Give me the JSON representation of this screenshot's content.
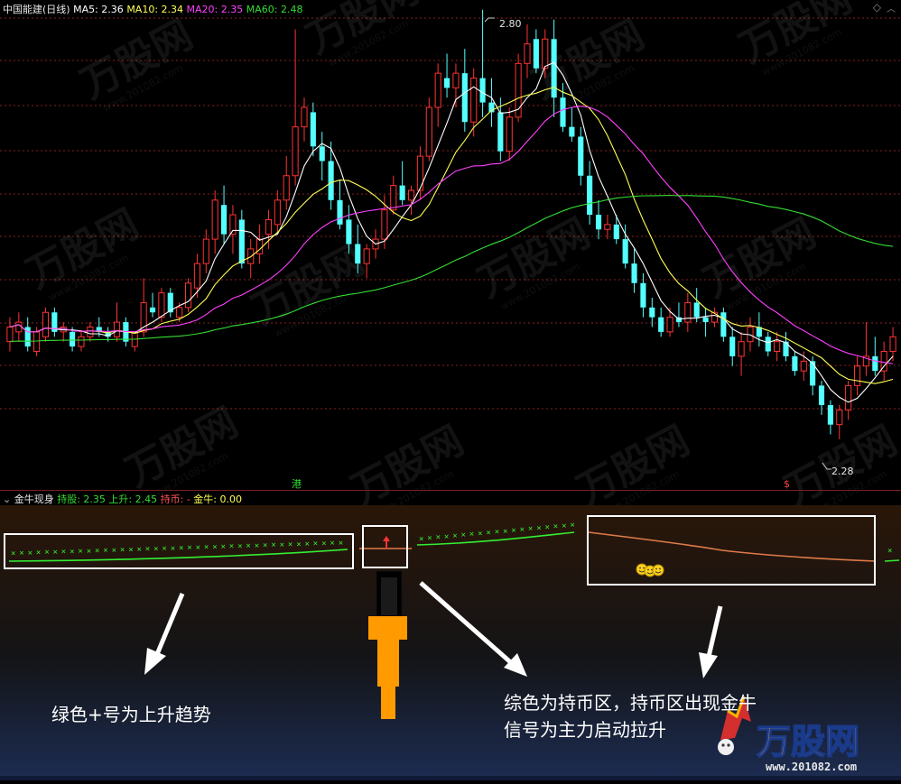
{
  "window": {
    "stock_title": "中国能建(日线)",
    "ma_items": [
      {
        "text": "MA5: 2.36",
        "color": "#ffffff"
      },
      {
        "text": "MA10: 2.34",
        "color": "#ffff54"
      },
      {
        "text": "MA20: 2.35",
        "color": "#ff40ff"
      },
      {
        "text": "MA60: 2.48",
        "color": "#33dd33"
      }
    ],
    "corner_icons": [
      "diamond-icon",
      "chevron-up-icon"
    ]
  },
  "main_chart": {
    "high_label": "2.80",
    "low_label": "2.28",
    "marker_left": "港",
    "marker_right": "$",
    "colors": {
      "up": "#ff3333",
      "down": "#54ffff",
      "ma5": "#ffffff",
      "ma10": "#ffff54",
      "ma20": "#ff40ff",
      "ma60": "#33dd33"
    }
  },
  "indicator": {
    "name": "金牛现身",
    "values": [
      {
        "text": "持股: 2.35",
        "color": "#33dd33"
      },
      {
        "text": "上升: 2.45",
        "color": "#33dd33"
      },
      {
        "text": "持币: -",
        "color": "#ff5555"
      },
      {
        "text": "金牛: 0.00",
        "color": "#ffff54"
      }
    ]
  },
  "annotations": {
    "left": "绿色+号为上升趋势",
    "right_line1": "综色为持币区，持币区出现金牛",
    "right_line2": "信号为主力启动拉升"
  },
  "watermark": {
    "brand": "万股网",
    "url": "www.201082.com"
  },
  "chart_data": {
    "type": "candlestick",
    "title": "中国能建(日线)",
    "ohlc": [
      [
        2.12,
        2.17,
        2.1,
        2.15
      ],
      [
        2.14,
        2.18,
        2.12,
        2.16
      ],
      [
        2.15,
        2.17,
        2.1,
        2.11
      ],
      [
        2.1,
        2.15,
        2.09,
        2.14
      ],
      [
        2.13,
        2.19,
        2.12,
        2.18
      ],
      [
        2.18,
        2.19,
        2.13,
        2.14
      ],
      [
        2.14,
        2.16,
        2.12,
        2.15
      ],
      [
        2.14,
        2.15,
        2.1,
        2.11
      ],
      [
        2.11,
        2.14,
        2.1,
        2.13
      ],
      [
        2.13,
        2.16,
        2.12,
        2.15
      ],
      [
        2.15,
        2.17,
        2.13,
        2.14
      ],
      [
        2.14,
        2.15,
        2.12,
        2.13
      ],
      [
        2.13,
        2.2,
        2.12,
        2.16
      ],
      [
        2.16,
        2.17,
        2.11,
        2.12
      ],
      [
        2.11,
        2.14,
        2.1,
        2.14
      ],
      [
        2.14,
        2.25,
        2.13,
        2.2
      ],
      [
        2.19,
        2.22,
        2.17,
        2.18
      ],
      [
        2.17,
        2.23,
        2.16,
        2.22
      ],
      [
        2.22,
        2.23,
        2.17,
        2.18
      ],
      [
        2.17,
        2.2,
        2.16,
        2.19
      ],
      [
        2.19,
        2.25,
        2.18,
        2.24
      ],
      [
        2.23,
        2.3,
        2.21,
        2.28
      ],
      [
        2.28,
        2.35,
        2.26,
        2.33
      ],
      [
        2.33,
        2.43,
        2.3,
        2.41
      ],
      [
        2.4,
        2.44,
        2.32,
        2.34
      ],
      [
        2.34,
        2.4,
        2.3,
        2.38
      ],
      [
        2.37,
        2.39,
        2.27,
        2.28
      ],
      [
        2.28,
        2.33,
        2.25,
        2.31
      ],
      [
        2.3,
        2.36,
        2.28,
        2.33
      ],
      [
        2.34,
        2.39,
        2.31,
        2.37
      ],
      [
        2.36,
        2.43,
        2.34,
        2.41
      ],
      [
        2.41,
        2.5,
        2.39,
        2.46
      ],
      [
        2.46,
        2.76,
        2.44,
        2.56
      ],
      [
        2.56,
        2.62,
        2.53,
        2.6
      ],
      [
        2.59,
        2.61,
        2.5,
        2.52
      ],
      [
        2.52,
        2.55,
        2.45,
        2.49
      ],
      [
        2.49,
        2.53,
        2.39,
        2.41
      ],
      [
        2.41,
        2.45,
        2.35,
        2.36
      ],
      [
        2.37,
        2.4,
        2.3,
        2.32
      ],
      [
        2.32,
        2.36,
        2.26,
        2.28
      ],
      [
        2.28,
        2.32,
        2.25,
        2.31
      ],
      [
        2.31,
        2.35,
        2.29,
        2.33
      ],
      [
        2.33,
        2.42,
        2.31,
        2.39
      ],
      [
        2.39,
        2.46,
        2.38,
        2.44
      ],
      [
        2.44,
        2.49,
        2.4,
        2.41
      ],
      [
        2.41,
        2.44,
        2.38,
        2.43
      ],
      [
        2.43,
        2.52,
        2.41,
        2.5
      ],
      [
        2.5,
        2.62,
        2.49,
        2.6
      ],
      [
        2.6,
        2.69,
        2.56,
        2.67
      ],
      [
        2.66,
        2.71,
        2.62,
        2.64
      ],
      [
        2.64,
        2.69,
        2.6,
        2.67
      ],
      [
        2.67,
        2.72,
        2.55,
        2.57
      ],
      [
        2.57,
        2.68,
        2.54,
        2.66
      ],
      [
        2.66,
        2.8,
        2.58,
        2.61
      ],
      [
        2.61,
        2.66,
        2.56,
        2.59
      ],
      [
        2.59,
        2.62,
        2.49,
        2.51
      ],
      [
        2.51,
        2.6,
        2.49,
        2.58
      ],
      [
        2.58,
        2.71,
        2.57,
        2.69
      ],
      [
        2.69,
        2.77,
        2.66,
        2.73
      ],
      [
        2.74,
        2.76,
        2.67,
        2.68
      ],
      [
        2.68,
        2.76,
        2.66,
        2.74
      ],
      [
        2.74,
        2.78,
        2.58,
        2.62
      ],
      [
        2.62,
        2.65,
        2.55,
        2.56
      ],
      [
        2.56,
        2.6,
        2.53,
        2.54
      ],
      [
        2.54,
        2.56,
        2.44,
        2.46
      ],
      [
        2.46,
        2.49,
        2.36,
        2.38
      ],
      [
        2.38,
        2.41,
        2.33,
        2.35
      ],
      [
        2.35,
        2.38,
        2.33,
        2.36
      ],
      [
        2.36,
        2.38,
        2.32,
        2.33
      ],
      [
        2.33,
        2.36,
        2.27,
        2.28
      ],
      [
        2.28,
        2.31,
        2.22,
        2.24
      ],
      [
        2.24,
        2.26,
        2.17,
        2.19
      ],
      [
        2.19,
        2.21,
        2.15,
        2.17
      ],
      [
        2.17,
        2.19,
        2.13,
        2.14
      ],
      [
        2.14,
        2.19,
        2.13,
        2.17
      ],
      [
        2.17,
        2.2,
        2.15,
        2.16
      ],
      [
        2.16,
        2.22,
        2.14,
        2.2
      ],
      [
        2.2,
        2.23,
        2.16,
        2.17
      ],
      [
        2.17,
        2.19,
        2.13,
        2.16
      ],
      [
        2.16,
        2.19,
        2.15,
        2.18
      ],
      [
        2.18,
        2.19,
        2.12,
        2.13
      ],
      [
        2.13,
        2.15,
        2.07,
        2.09
      ],
      [
        2.09,
        2.14,
        2.05,
        2.12
      ],
      [
        2.12,
        2.17,
        2.1,
        2.15
      ],
      [
        2.15,
        2.18,
        2.11,
        2.13
      ],
      [
        2.13,
        2.14,
        2.09,
        2.1
      ],
      [
        2.1,
        2.14,
        2.08,
        2.12
      ],
      [
        2.12,
        2.14,
        2.08,
        2.09
      ],
      [
        2.09,
        2.1,
        2.05,
        2.06
      ],
      [
        2.06,
        2.1,
        2.04,
        2.08
      ],
      [
        2.08,
        2.09,
        2.01,
        2.03
      ],
      [
        2.03,
        2.04,
        1.97,
        1.99
      ],
      [
        1.99,
        2.0,
        1.93,
        1.95
      ],
      [
        1.95,
        1.99,
        1.92,
        1.98
      ],
      [
        1.98,
        2.04,
        1.96,
        2.03
      ],
      [
        2.03,
        2.09,
        2.01,
        2.07
      ],
      [
        2.07,
        2.16,
        2.05,
        2.09
      ],
      [
        2.09,
        2.13,
        2.05,
        2.06
      ],
      [
        2.06,
        2.12,
        2.04,
        2.1
      ],
      [
        2.1,
        2.15,
        2.08,
        2.13
      ]
    ],
    "ma_periods": [
      5,
      10,
      20,
      60
    ],
    "ma60_start": 2.12,
    "ylim": [
      1.82,
      2.82
    ],
    "grid": true
  }
}
